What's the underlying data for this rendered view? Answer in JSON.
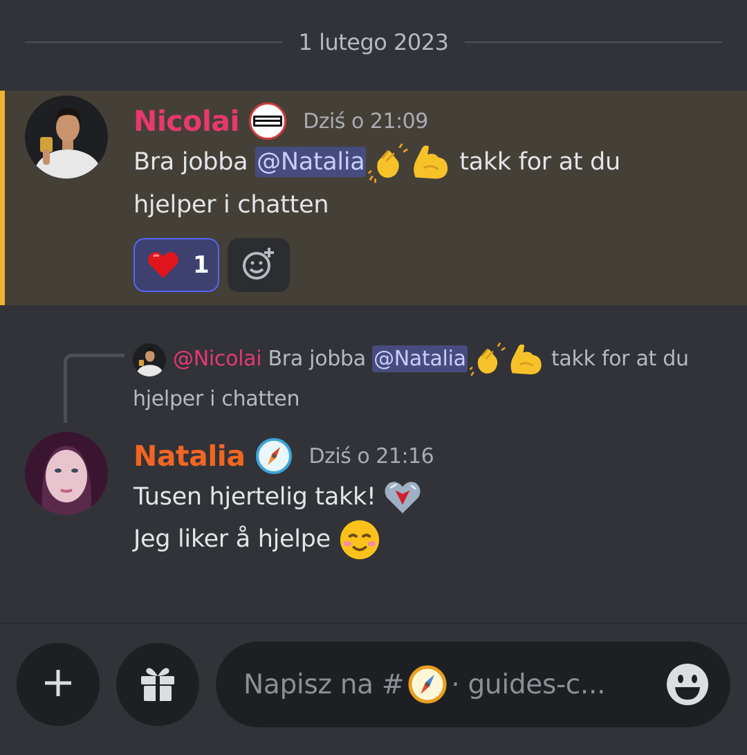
{
  "date_divider": "1 lutego 2023",
  "messages": [
    {
      "username": "Nicolai",
      "timestamp": "Dziś o 21:09",
      "text_before": "Bra jobba ",
      "mention": "@Natalia",
      "text_after": " takk for at du hjelper i chatten",
      "highlighted": true,
      "accent_color": "#f0b232",
      "name_color": "#e8386f",
      "reactions": [
        {
          "emoji": "heart",
          "count": "1"
        }
      ]
    },
    {
      "username": "Natalia",
      "timestamp": "Dziś o 21:16",
      "name_color": "#f26522",
      "lines": [
        "Tusen hjertelig takk!",
        "Jeg liker å hjelpe"
      ],
      "reply_to": {
        "username": "@Nicolai",
        "text_before": "Bra jobba ",
        "mention": "@Natalia",
        "text_after": " takk for at du hjelper i chatten"
      }
    }
  ],
  "composer": {
    "placeholder_prefix": "Napisz na #",
    "placeholder_suffix": "· guides-c..."
  },
  "icons": {
    "plus": "plus-icon",
    "gift": "gift-icon",
    "emoji_picker": "emoji-smile-icon",
    "add_reaction": "add-reaction-icon"
  }
}
